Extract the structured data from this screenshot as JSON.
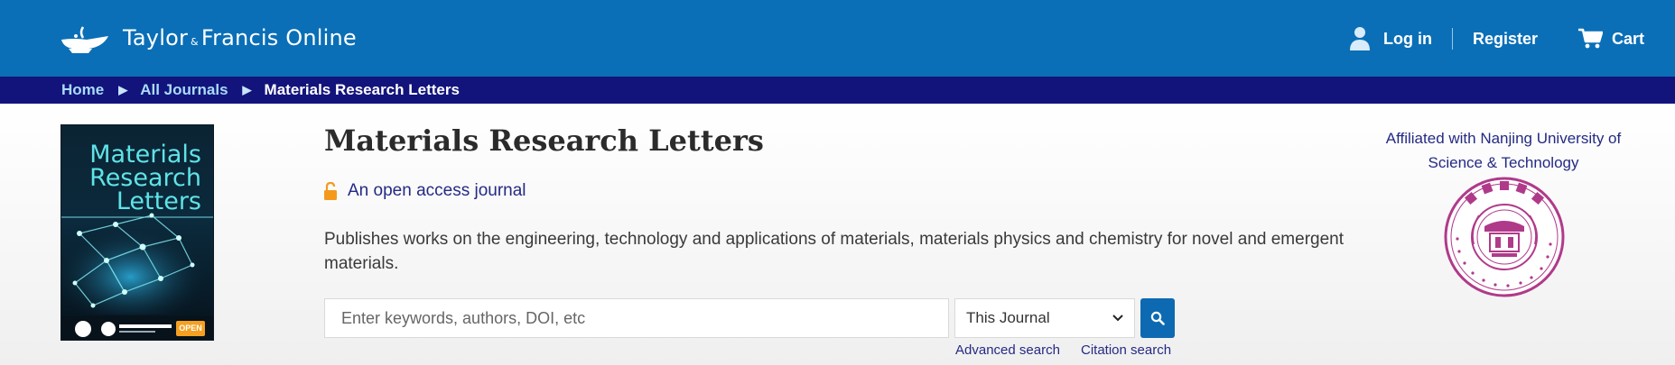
{
  "header": {
    "brand_name": "Taylor",
    "brand_amp": "&",
    "brand_name_2": "Francis Online",
    "login_label": "Log in",
    "register_label": "Register",
    "cart_label": "Cart"
  },
  "breadcrumb": {
    "items": [
      "Home",
      "All Journals",
      "Materials Research Letters"
    ]
  },
  "journal": {
    "cover_line1": "Materials",
    "cover_line2": "Research",
    "cover_line3": "Letters",
    "cover_badge": "OPEN",
    "title": "Materials Research Letters",
    "open_access": "An open access journal",
    "description": "Publishes works on the engineering, technology and applications of materials, materials physics and chemistry for novel and emergent materials.",
    "affiliation": "Affiliated with Nanjing University of Science & Technology"
  },
  "search": {
    "placeholder": "Enter keywords, authors, DOI, etc",
    "scope_selected": "This Journal",
    "advanced_label": "Advanced search",
    "citation_label": "Citation search"
  },
  "colors": {
    "header_blue": "#0a6fb7",
    "breadcrumb_navy": "#12147b",
    "link_blue": "#242a84",
    "lock_orange": "#f39a1d",
    "seal_magenta": "#b03a8a"
  }
}
